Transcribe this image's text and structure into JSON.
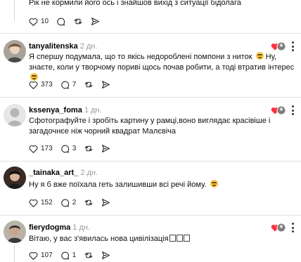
{
  "top_comment": {
    "text": "Рік не кормили його ось і знайшов вихід з ситуації бідолага",
    "likes": "10"
  },
  "comments": [
    {
      "username": "tanyalitenska",
      "time": "2 дн.",
      "text_a": "Я спершу подумала, що то якісь недороблені помпони з ниток",
      "text_b": "Ну, знаєте, коли у творчому пориві щось почав робити, а тоді втратив інтерес",
      "likes": "373",
      "replies": "7"
    },
    {
      "username": "kssenya_foma",
      "time": "1 дн.",
      "text": "Сфотографуйте і зробіть картину у рамці,воно виглядає красівіше і загадочнєе ніж чорний квадрат Малєвіча",
      "likes": "173",
      "replies": "3"
    },
    {
      "username": "_tainaka_art_",
      "time": "2 дн.",
      "text": "Ну я б вже поїхала геть залишивши всі речі йому.",
      "likes": "152",
      "replies": "2"
    },
    {
      "username": "fierydogma",
      "time": "1 дн.",
      "text": "Вітаю, у вас з'явилась нова цивілізація",
      "likes": "107",
      "replies": "1"
    }
  ]
}
